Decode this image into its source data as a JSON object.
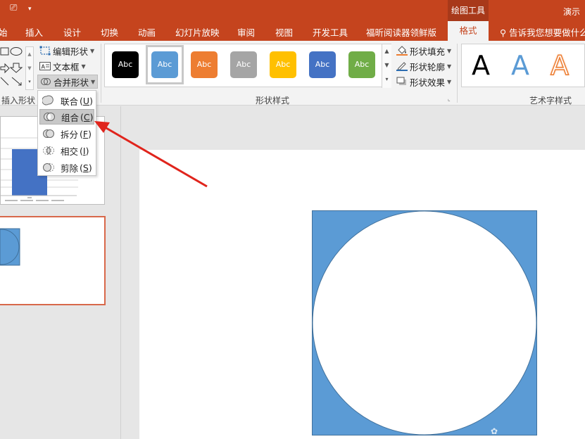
{
  "titlebar": {
    "context_tab_group": "绘图工具",
    "document_title": "演示"
  },
  "tabs": {
    "home_partial": "始",
    "insert": "插入",
    "design": "设计",
    "transitions": "切换",
    "animations": "动画",
    "slideshow": "幻灯片放映",
    "review": "审阅",
    "view": "视图",
    "developer": "开发工具",
    "foxit": "福昕阅读器领鲜版",
    "format": "格式",
    "tell_me": "告诉我您想要做什么"
  },
  "ribbon": {
    "insert_shapes": {
      "label": "插入形状",
      "edit_shape": "编辑形状",
      "text_box": "文本框",
      "merge_shapes": "合并形状"
    },
    "shape_styles": {
      "label": "形状样式",
      "swatch_text": "Abc",
      "swatches": [
        {
          "color": "#000000",
          "selected": false
        },
        {
          "color": "#5b9bd5",
          "selected": true
        },
        {
          "color": "#ed7d31",
          "selected": false
        },
        {
          "color": "#a5a5a5",
          "selected": false
        },
        {
          "color": "#ffc000",
          "selected": false
        },
        {
          "color": "#4472c4",
          "selected": false
        },
        {
          "color": "#70ad47",
          "selected": false
        }
      ],
      "shape_fill": "形状填充",
      "shape_outline": "形状轮廓",
      "shape_effects": "形状效果"
    },
    "wordart_styles": {
      "label": "艺术字样式",
      "samples": [
        "A",
        "A",
        "A"
      ]
    }
  },
  "merge_menu": {
    "items": [
      {
        "label": "联合",
        "key": "U"
      },
      {
        "label": "组合",
        "key": "C"
      },
      {
        "label": "拆分",
        "key": "F"
      },
      {
        "label": "相交",
        "key": "I"
      },
      {
        "label": "剪除",
        "key": "S"
      }
    ],
    "hovered_index": 1
  },
  "colors": {
    "accent": "#c5441e",
    "shape_fill": "#5b9bd5",
    "shape_outline": "#41719c",
    "arrow": "#e0241c"
  }
}
